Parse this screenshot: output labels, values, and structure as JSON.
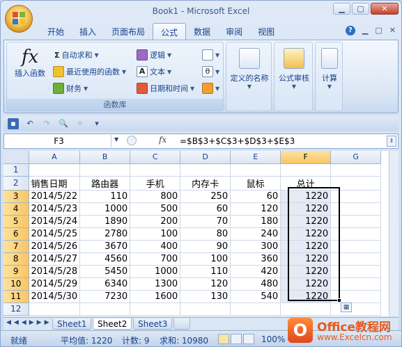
{
  "window": {
    "title": "Book1 - Microsoft Excel"
  },
  "tabs": [
    "开始",
    "插入",
    "页面布局",
    "公式",
    "数据",
    "审阅",
    "视图"
  ],
  "ribbon": {
    "insert_function": "插入函数",
    "autosum": "自动求和",
    "recent": "最近使用的函数",
    "financial": "财务",
    "logical": "逻辑",
    "text": "文本",
    "datetime": "日期和时间",
    "library_label": "函数库",
    "defined_names": "定义的名称",
    "auditing": "公式审核",
    "calculation": "计算"
  },
  "formula_bar": {
    "name_box": "F3",
    "fx": "fx",
    "formula": "=$B$3+$C$3+$D$3+$E$3"
  },
  "sheet": {
    "columns": [
      "A",
      "B",
      "C",
      "D",
      "E",
      "F",
      "G"
    ],
    "headers": [
      "销售日期",
      "路由器",
      "手机",
      "内存卡",
      "鼠标",
      "总计"
    ],
    "rows": [
      [
        "2014/5/22",
        "110",
        "800",
        "250",
        "60",
        "1220"
      ],
      [
        "2014/5/23",
        "1000",
        "500",
        "60",
        "120",
        "1220"
      ],
      [
        "2014/5/24",
        "1890",
        "200",
        "70",
        "180",
        "1220"
      ],
      [
        "2014/5/25",
        "2780",
        "100",
        "80",
        "240",
        "1220"
      ],
      [
        "2014/5/26",
        "3670",
        "400",
        "90",
        "300",
        "1220"
      ],
      [
        "2014/5/27",
        "4560",
        "700",
        "100",
        "360",
        "1220"
      ],
      [
        "2014/5/28",
        "5450",
        "1000",
        "110",
        "420",
        "1220"
      ],
      [
        "2014/5/29",
        "6340",
        "1300",
        "120",
        "480",
        "1220"
      ],
      [
        "2014/5/30",
        "7230",
        "1600",
        "130",
        "540",
        "1220"
      ]
    ]
  },
  "sheet_tabs": [
    "Sheet1",
    "Sheet2",
    "Sheet3"
  ],
  "status": {
    "ready": "就绪",
    "average": "平均值: 1220",
    "count": "计数: 9",
    "sum": "求和: 10980",
    "zoom": "100%"
  },
  "watermark": {
    "logo_letter": "O",
    "title": "Office教程网",
    "url": "www.Excelcn.com"
  }
}
